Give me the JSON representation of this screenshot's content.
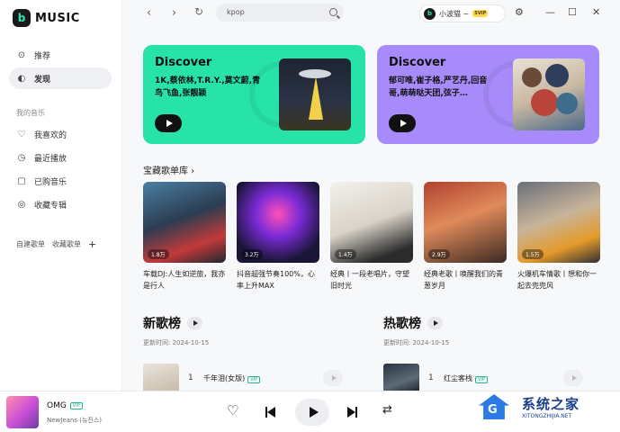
{
  "app": {
    "logo_letter": "b",
    "name": "MUSIC"
  },
  "sidebar": {
    "items": [
      {
        "label": "推荐",
        "icon": "play-circle-icon"
      },
      {
        "label": "发现",
        "icon": "planet-icon"
      }
    ],
    "my_music_label": "我的音乐",
    "my_items": [
      {
        "label": "我喜欢的",
        "icon": "heart-icon"
      },
      {
        "label": "最近播放",
        "icon": "clock-icon"
      },
      {
        "label": "已购音乐",
        "icon": "bag-icon"
      },
      {
        "label": "收藏专辑",
        "icon": "disc-icon"
      }
    ],
    "playlist_tabs": [
      "自建歌单",
      "收藏歌单"
    ],
    "add": "+"
  },
  "topbar": {
    "back": "‹",
    "forward": "›",
    "refresh": "↻",
    "search_value": "kpop",
    "user_name": "小波猫 ~",
    "vip": "SVIP",
    "settings": "⚙",
    "minimize": "—",
    "maximize": "☐",
    "close": "✕"
  },
  "banners": [
    {
      "title": "Discover",
      "desc": "1K,蔡依林,T.R.Y.,莫文蔚,青鸟飞鱼,张靓颖",
      "color": "#27e3a8"
    },
    {
      "title": "Discover",
      "desc": "郁可唯,崔子格,严艺丹,回音哥,萌萌哒天团,弦子…",
      "color": "#a78bfa"
    }
  ],
  "treasure": {
    "title": "宝藏歌单库 ›",
    "cards": [
      {
        "count": "1.8万",
        "title": "车载DJ:人生如逆旅，我亦是行人"
      },
      {
        "count": "3.2万",
        "title": "抖音超强节奏100%，心率上升MAX"
      },
      {
        "count": "1.4万",
        "title": "经典丨一段老唱片，守望旧时光"
      },
      {
        "count": "2.9万",
        "title": "经典老歌丨唤醒我们的青葱岁月"
      },
      {
        "count": "1.5万",
        "title": "火爆机车情歌丨想和你一起去兜兜风"
      }
    ]
  },
  "new_chart": {
    "title": "新歌榜",
    "update": "更新时间: 2024-10-15",
    "rank": "1",
    "song": "千年泪(女版)",
    "vip": "VIP"
  },
  "hot_chart": {
    "title": "热歌榜",
    "update": "更新时间: 2024-10-15",
    "rank": "1",
    "song": "红尘客栈",
    "vip": "VIP"
  },
  "player": {
    "title": "OMG",
    "vip": "VIP",
    "artist": "NewJeans (뉴진스)",
    "like": "♡",
    "shuffle": "⇄"
  },
  "watermark": {
    "letter": "G",
    "cn": "系统之家",
    "url": "XITONGZHIJIA.NET"
  }
}
